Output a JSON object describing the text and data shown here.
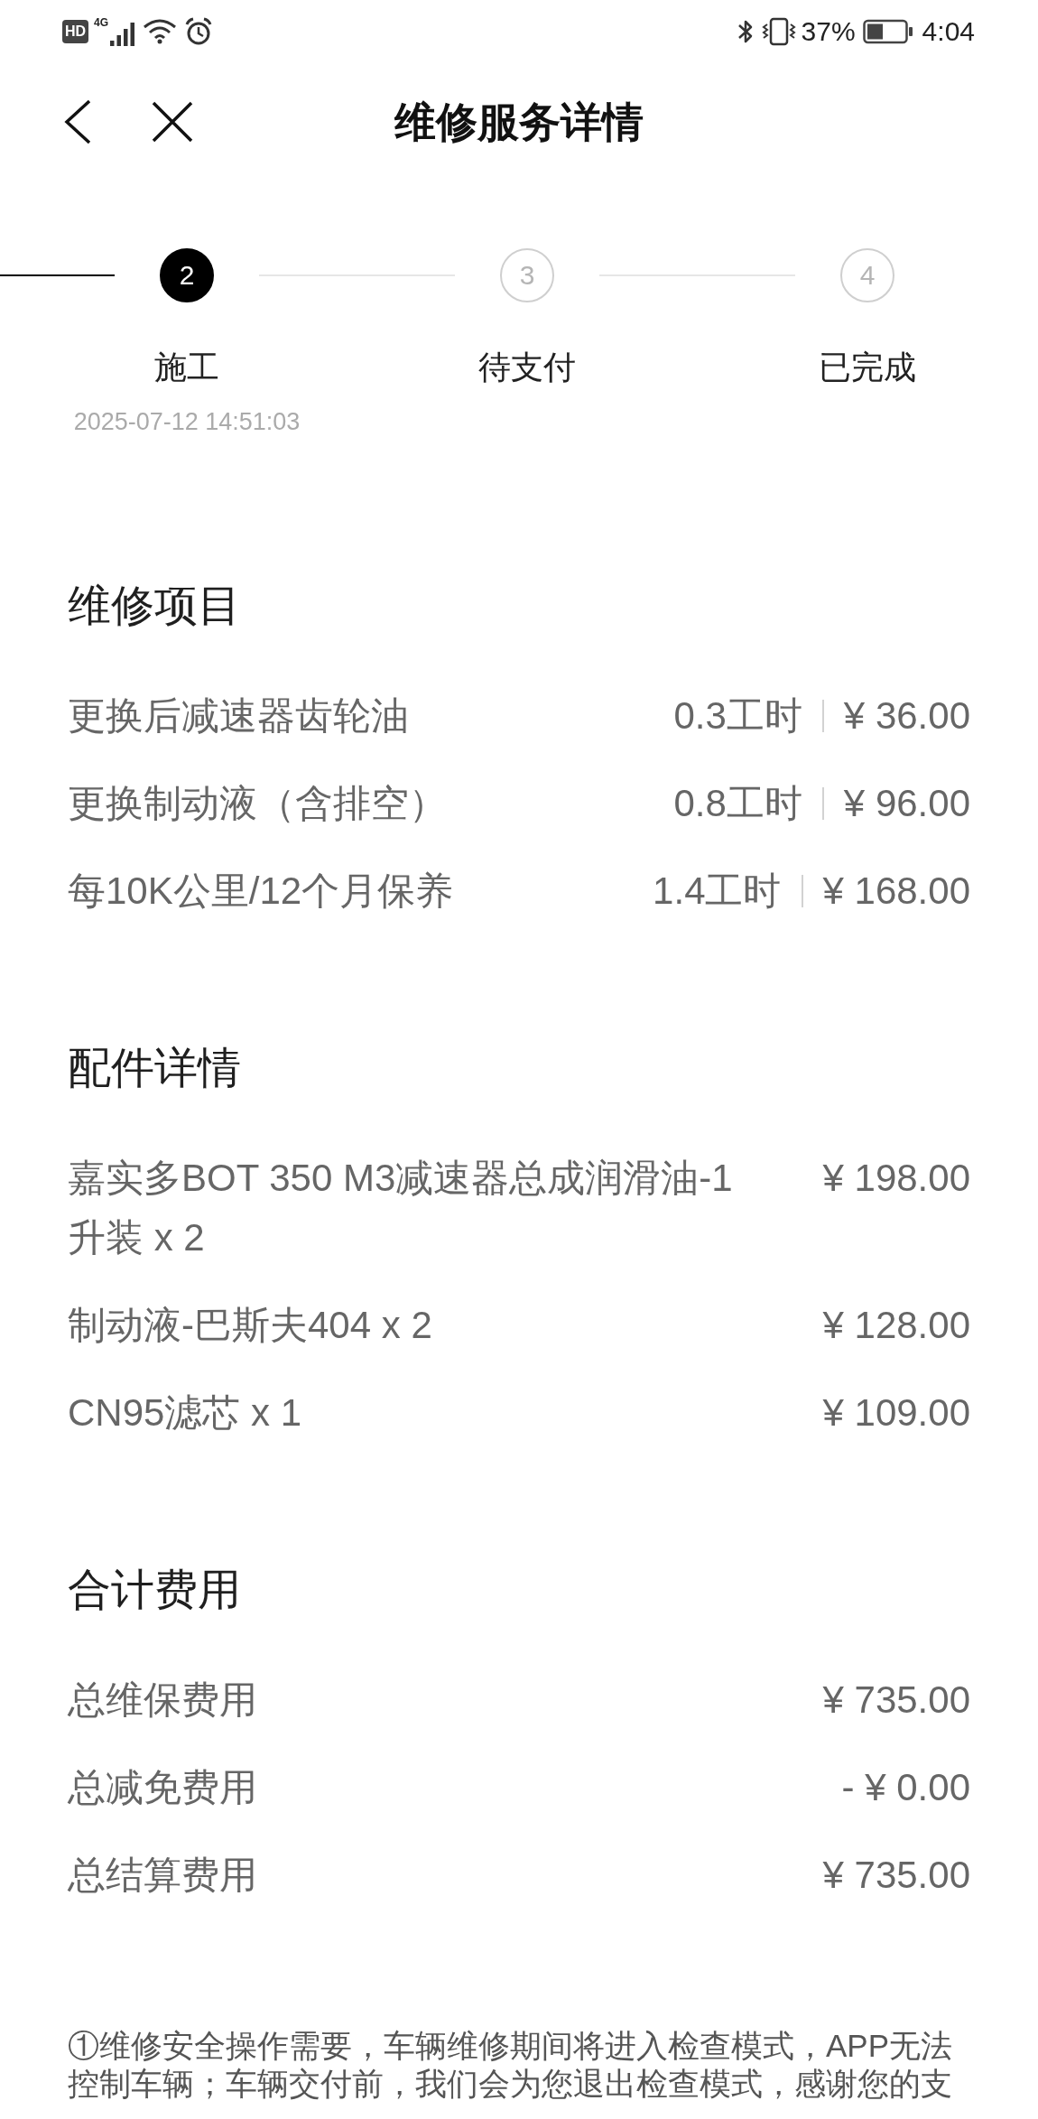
{
  "status_bar": {
    "hd_badge": "HD",
    "network": "4G",
    "battery": "37%",
    "time": "4:04"
  },
  "header": {
    "title": "维修服务详情"
  },
  "stepper": {
    "steps": [
      {
        "number": "2",
        "label": "施工",
        "date": "2025-07-12 14:51:03",
        "current": true
      },
      {
        "number": "3",
        "label": "待支付",
        "current": false
      },
      {
        "number": "4",
        "label": "已完成",
        "current": false
      }
    ]
  },
  "sections": [
    {
      "title": "维修项目",
      "kind": "labor",
      "rows": [
        {
          "name": "更换后减速器齿轮油",
          "hours": "0.3工时",
          "price": "¥ 36.00"
        },
        {
          "name": "更换制动液（含排空）",
          "hours": "0.8工时",
          "price": "¥ 96.00"
        },
        {
          "name": "每10K公里/12个月保养",
          "hours": "1.4工时",
          "price": "¥ 168.00"
        }
      ]
    },
    {
      "title": "配件详情",
      "kind": "parts",
      "rows": [
        {
          "name": "嘉实多BOT 350 M3减速器总成润滑油-1升装 x 2",
          "price": "¥ 198.00"
        },
        {
          "name": "制动液-巴斯夫404 x 2",
          "price": "¥ 128.00"
        },
        {
          "name": "CN95滤芯 x 1",
          "price": "¥ 109.00"
        }
      ]
    },
    {
      "title": "合计费用",
      "kind": "totals",
      "rows": [
        {
          "name": "总维保费用",
          "price": "¥ 735.00"
        },
        {
          "name": "总减免费用",
          "price": "- ¥ 0.00"
        },
        {
          "name": "总结算费用",
          "price": "¥ 735.00"
        }
      ]
    }
  ],
  "note": "①维修安全操作需要，车辆维修期间将进入检查模式，APP无法控制车辆；车辆交付前，我们会为您退出检查模式，感谢您的支"
}
